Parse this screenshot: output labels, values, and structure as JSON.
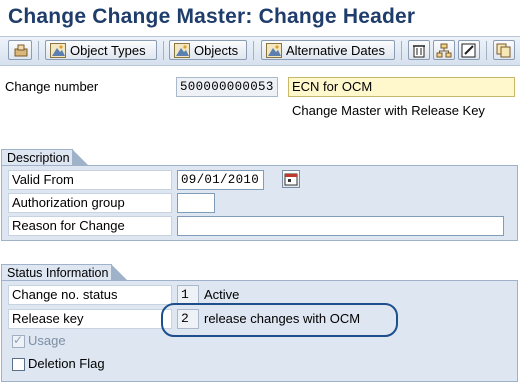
{
  "window": {
    "title": "Change Change Master: Change Header"
  },
  "toolbar": {
    "buttons": [
      {
        "icon": "hold-icon",
        "label": ""
      },
      {
        "icon": "mountain-icon",
        "label": "Object Types"
      },
      {
        "icon": "mountain-icon",
        "label": "Objects"
      },
      {
        "icon": "mountain-icon",
        "label": "Alternative Dates"
      },
      {
        "icon": "trash-icon",
        "label": ""
      },
      {
        "icon": "hierarchy-icon",
        "label": ""
      },
      {
        "icon": "edit-icon",
        "label": ""
      },
      {
        "icon": "copy-icon",
        "label": ""
      }
    ]
  },
  "header": {
    "change_number_label": "Change number",
    "change_number_value": "500000000053",
    "description_value": "ECN for OCM",
    "subtitle": "Change Master with Release Key"
  },
  "description_group": {
    "title": "Description",
    "valid_from_label": "Valid From",
    "valid_from_value": "09/01/2010",
    "authorization_group_label": "Authorization group",
    "authorization_group_value": "",
    "reason_label": "Reason for Change",
    "reason_value": ""
  },
  "status_group": {
    "title": "Status Information",
    "change_status_label": "Change no. status",
    "change_status_value": "1",
    "change_status_text": "Active",
    "release_key_label": "Release key",
    "release_key_value": "2",
    "release_key_text": "release changes with OCM",
    "usage_label": "Usage",
    "usage_checked": true,
    "deletion_flag_label": "Deletion Flag",
    "deletion_flag_checked": false
  }
}
